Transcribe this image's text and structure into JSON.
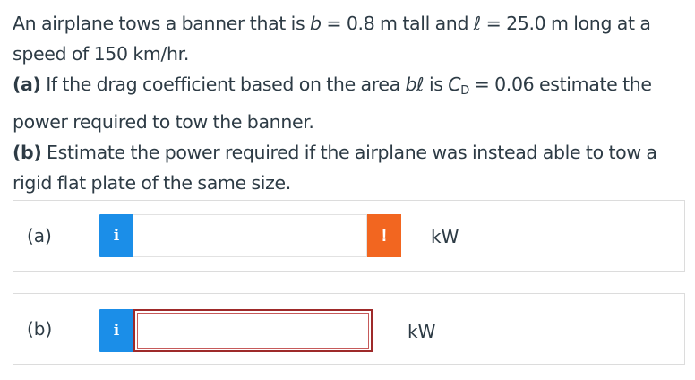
{
  "problem": {
    "s1_text": "An airplane tows a banner that is ",
    "s1_var_b": "b",
    "s1_eq1": " = 0.8 m tall and ",
    "s1_var_l": "ℓ",
    "s1_eq2": " = 25.0 m long at a speed of 150 km/hr.",
    "a_label": "(a)",
    "a_text1": " If the drag coefficient based on the area ",
    "a_var_bl": "bℓ",
    "a_text2": " is ",
    "a_cd": "C",
    "a_cd_sub": "D",
    "a_text3": " = 0.06 estimate the power required to tow the banner.",
    "b_label": "(b)",
    "b_text": " Estimate the power required if the airplane was instead able to tow a rigid flat plate of the same size."
  },
  "answers": [
    {
      "label": "(a)",
      "info_glyph": "i",
      "value": "",
      "alert_glyph": "!",
      "unit": "kW",
      "status_color": "#f26620"
    },
    {
      "label": "(b)",
      "info_glyph": "i",
      "value": "",
      "unit": "kW",
      "status_color": "#9e2a2a"
    }
  ],
  "colors": {
    "info": "#1b8ee8",
    "alert": "#f26620",
    "error_border": "#9e2a2a",
    "text": "#2d3b45"
  }
}
